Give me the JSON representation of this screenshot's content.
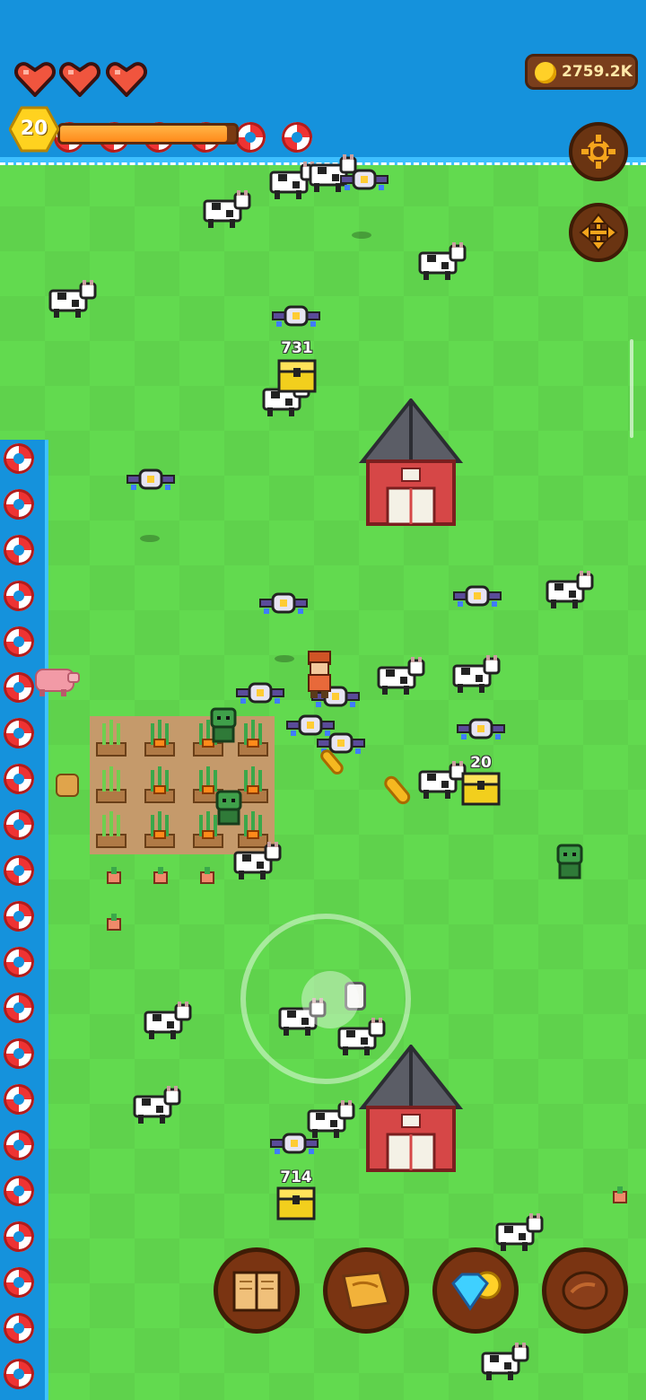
{
  "hud": {
    "hearts": [
      "heart-full",
      "heart-full",
      "heart-full"
    ],
    "level": "20",
    "xp_progress": 0.95,
    "coins": "2759.2K"
  },
  "buttons": {
    "settings_icon": "gear-icon",
    "move_icon": "move-arrows-icon"
  },
  "chests": [
    {
      "value": "731"
    },
    {
      "value": "20"
    },
    {
      "value": "714"
    }
  ],
  "bottom_menu": [
    {
      "name": "book",
      "icon": "book-icon"
    },
    {
      "name": "map",
      "icon": "map-scroll-icon"
    },
    {
      "name": "shop",
      "icon": "gem-coin-icon"
    },
    {
      "name": "meat",
      "icon": "meat-icon"
    }
  ],
  "colors": {
    "sea": "#1592dc",
    "grass": "#62da4f",
    "accent_orange": "#ff8a1a",
    "button_brown": "#6a3412"
  }
}
